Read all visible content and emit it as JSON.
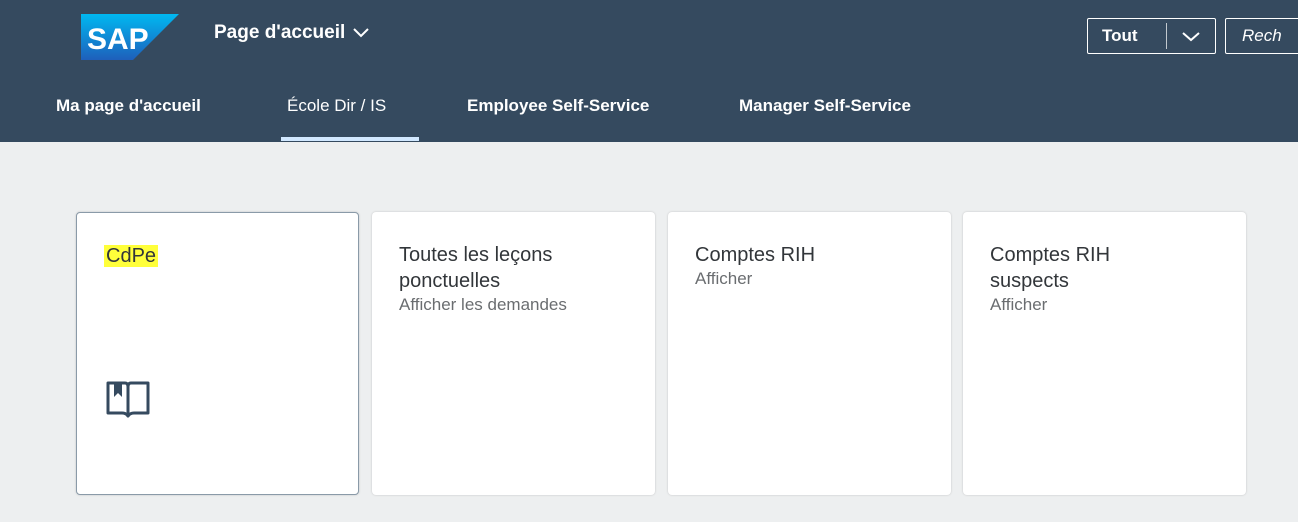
{
  "header": {
    "logo_text": "SAP",
    "home_title": "Page d'accueil",
    "scope_select": "Tout",
    "search_placeholder": "Rech"
  },
  "tabs": [
    {
      "label": "Ma page d'accueil"
    },
    {
      "label": "École Dir / IS",
      "active": true
    },
    {
      "label": "Employee Self-Service"
    },
    {
      "label": "Manager Self-Service"
    }
  ],
  "tiles": [
    {
      "title": "CdPe",
      "subtitle": "",
      "icon": "book-icon",
      "selected": true
    },
    {
      "title": "Toutes les leçons ponctuelles",
      "subtitle": "Afficher les demandes"
    },
    {
      "title": "Comptes RIH",
      "subtitle": "Afficher"
    },
    {
      "title": "Comptes RIH suspects",
      "subtitle": "Afficher"
    }
  ],
  "colors": {
    "shell": "#354a5f",
    "background": "#edeff0",
    "tab_indicator": "#d1e8ff",
    "highlight": "#ffff3a",
    "icon": "#354a5f"
  }
}
